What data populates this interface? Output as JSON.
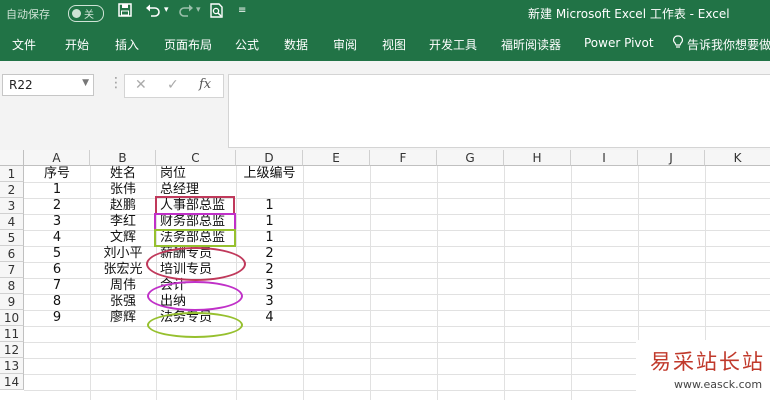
{
  "titlebar": {
    "autosave_label": "自动保存",
    "autosave_state": "关",
    "window_title": "新建 Microsoft Excel 工作表 - Excel"
  },
  "ribbon": {
    "tabs": [
      "文件",
      "开始",
      "插入",
      "页面布局",
      "公式",
      "数据",
      "审阅",
      "视图",
      "开发工具",
      "福昕阅读器",
      "Power Pivot"
    ],
    "tell_me": "告诉我你想要做什"
  },
  "formula_bar": {
    "name_box": "R22",
    "cancel": "✕",
    "enter": "✓",
    "fx": "fx",
    "content": ""
  },
  "columns": [
    "A",
    "B",
    "C",
    "D",
    "E",
    "F",
    "G",
    "H",
    "I",
    "J",
    "K"
  ],
  "rows": [
    "1",
    "2",
    "3",
    "4",
    "5",
    "6",
    "7",
    "8",
    "9",
    "10",
    "11",
    "12",
    "13",
    "14"
  ],
  "table": [
    {
      "a": "序号",
      "b": "姓名",
      "c": "岗位",
      "d": "上级编号"
    },
    {
      "a": "1",
      "b": "张伟",
      "c": "总经理",
      "d": ""
    },
    {
      "a": "2",
      "b": "赵鹏",
      "c": "人事部总监",
      "d": "1"
    },
    {
      "a": "3",
      "b": "李红",
      "c": "财务部总监",
      "d": "1"
    },
    {
      "a": "4",
      "b": "文辉",
      "c": "法务部总监",
      "d": "1"
    },
    {
      "a": "5",
      "b": "刘小平",
      "c": "薪酬专员",
      "d": "2"
    },
    {
      "a": "6",
      "b": "张宏光",
      "c": "培训专员",
      "d": "2"
    },
    {
      "a": "7",
      "b": "周伟",
      "c": "会计",
      "d": "3"
    },
    {
      "a": "8",
      "b": "张强",
      "c": "出纳",
      "d": "3"
    },
    {
      "a": "9",
      "b": "廖辉",
      "c": "法务专员",
      "d": "4"
    }
  ],
  "annotation_colors": {
    "hr": "#c0395b",
    "finance": "#c030c8",
    "legal": "#96c02e"
  },
  "watermark": {
    "line1": "易采站长站",
    "line2": "www.easck.com"
  }
}
